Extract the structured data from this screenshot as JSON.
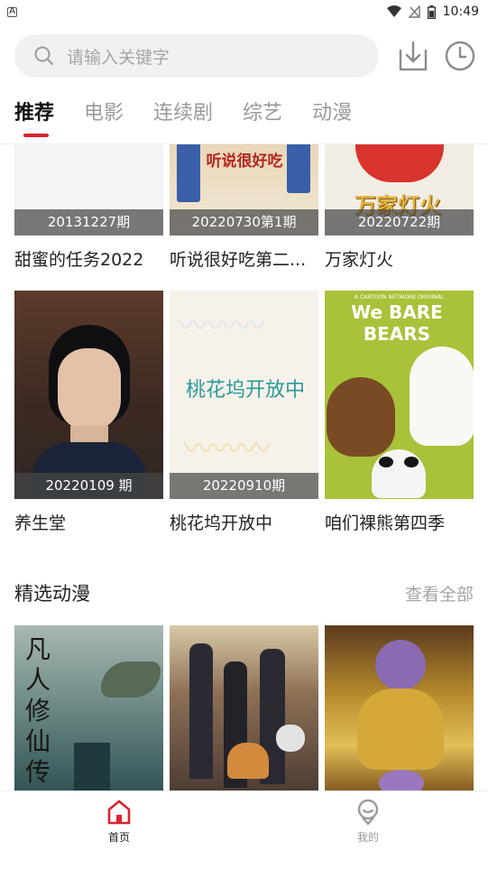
{
  "status_bar": {
    "app_indicator": "A",
    "time": "10:49"
  },
  "search": {
    "placeholder": "请输入关键字"
  },
  "tabs": [
    {
      "label": "推荐",
      "active": true
    },
    {
      "label": "电影",
      "active": false
    },
    {
      "label": "连续剧",
      "active": false
    },
    {
      "label": "综艺",
      "active": false
    },
    {
      "label": "动漫",
      "active": false
    }
  ],
  "row1": [
    {
      "title": "甜蜜的任务2022",
      "episode": "20131227期",
      "poster_text": ""
    },
    {
      "title": "听说很好吃第二...",
      "episode": "20220730第1期",
      "poster_text": "听说很好吃"
    },
    {
      "title": "万家灯火",
      "episode": "20220722期",
      "poster_text": "万家灯火"
    }
  ],
  "row2": [
    {
      "title": "养生堂",
      "episode": "20220109 期",
      "poster_text": ""
    },
    {
      "title": "桃花坞开放中",
      "episode": "20220910期",
      "poster_text": "桃花坞开放中"
    },
    {
      "title": "咱们裸熊第四季",
      "episode": "",
      "poster_text": "We BARE BEARS",
      "poster_subtext": "A CARTOON NETWORK ORIGINAL"
    }
  ],
  "section": {
    "title": "精选动漫",
    "more": "查看全部"
  },
  "row3": [
    {
      "poster_text": "凡人修仙传"
    },
    {
      "poster_text": ""
    },
    {
      "poster_text": ""
    }
  ],
  "bottom_nav": [
    {
      "label": "首页",
      "icon": "home-icon",
      "active": true
    },
    {
      "label": "我的",
      "icon": "profile-icon",
      "active": false
    }
  ],
  "colors": {
    "accent": "#d9232e",
    "inactive": "#9a9a9a"
  }
}
